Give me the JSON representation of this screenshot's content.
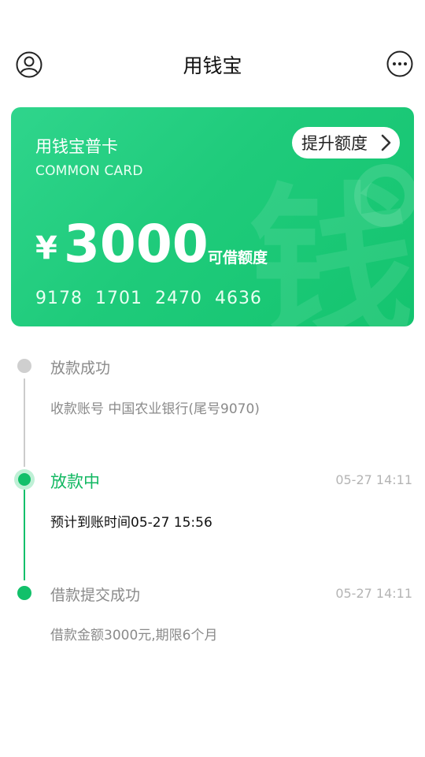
{
  "header": {
    "title": "用钱宝",
    "avatar_icon": "user-circle-icon",
    "more_icon": "more-dots-icon"
  },
  "card": {
    "name": "用钱宝普卡",
    "subtitle": "COMMON CARD",
    "upgrade_label": "提升额度",
    "currency": "¥",
    "amount": "3000",
    "amount_label": "可借额度",
    "number": "9178 1701 2470 4636",
    "watermark_char": "钱",
    "colors": {
      "gradient_start": "#2fd58c",
      "gradient_end": "#14c46f"
    }
  },
  "timeline": {
    "steps": [
      {
        "title": "放款成功",
        "desc": "收款账号 中国农业银行(尾号9070)",
        "time": "",
        "state": "pending"
      },
      {
        "title": "放款中",
        "desc": "预计到账时间05-27 15:56",
        "time": "05-27 14:11",
        "state": "active"
      },
      {
        "title": "借款提交成功",
        "desc": "借款金额3000元,期限6个月",
        "time": "05-27 14:11",
        "state": "done"
      }
    ],
    "colors": {
      "active": "#12c06a",
      "pending": "#cfcfcf"
    }
  }
}
